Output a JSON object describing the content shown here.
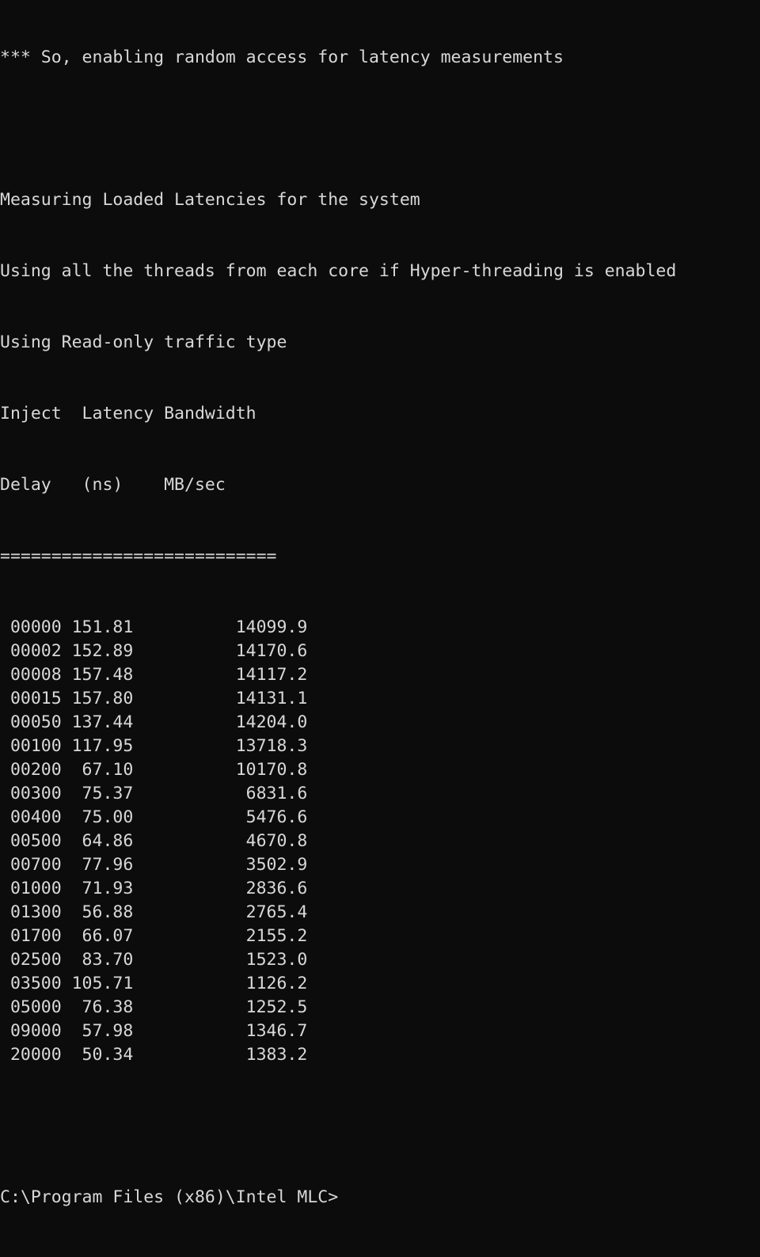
{
  "terminal": {
    "background_color": "#0c0c0c",
    "foreground_color": "#d8d8d8",
    "columns": 80,
    "rows": 29
  },
  "output": {
    "note_line": "*** So, enabling random access for latency measurements",
    "measuring_line": "Measuring Loaded Latencies for the system",
    "threads_line": "Using all the threads from each core if Hyper-threading is enabled",
    "traffic_line": "Using Read-only traffic type",
    "header_row_1": "Inject  Latency Bandwidth",
    "header_row_2": "Delay   (ns)    MB/sec",
    "separator": "==========================="
  },
  "table": {
    "columns": [
      "Inject Delay",
      "Latency (ns)",
      "Bandwidth MB/sec"
    ],
    "rows": [
      {
        "delay": "00000",
        "latency": "151.81",
        "bandwidth": "14099.9"
      },
      {
        "delay": "00002",
        "latency": "152.89",
        "bandwidth": "14170.6"
      },
      {
        "delay": "00008",
        "latency": "157.48",
        "bandwidth": "14117.2"
      },
      {
        "delay": "00015",
        "latency": "157.80",
        "bandwidth": "14131.1"
      },
      {
        "delay": "00050",
        "latency": "137.44",
        "bandwidth": "14204.0"
      },
      {
        "delay": "00100",
        "latency": "117.95",
        "bandwidth": "13718.3"
      },
      {
        "delay": "00200",
        "latency": "67.10",
        "bandwidth": "10170.8"
      },
      {
        "delay": "00300",
        "latency": "75.37",
        "bandwidth": "6831.6"
      },
      {
        "delay": "00400",
        "latency": "75.00",
        "bandwidth": "5476.6"
      },
      {
        "delay": "00500",
        "latency": "64.86",
        "bandwidth": "4670.8"
      },
      {
        "delay": "00700",
        "latency": "77.96",
        "bandwidth": "3502.9"
      },
      {
        "delay": "01000",
        "latency": "71.93",
        "bandwidth": "2836.6"
      },
      {
        "delay": "01300",
        "latency": "56.88",
        "bandwidth": "2765.4"
      },
      {
        "delay": "01700",
        "latency": "66.07",
        "bandwidth": "2155.2"
      },
      {
        "delay": "02500",
        "latency": "83.70",
        "bandwidth": "1523.0"
      },
      {
        "delay": "03500",
        "latency": "105.71",
        "bandwidth": "1126.2"
      },
      {
        "delay": "05000",
        "latency": "76.38",
        "bandwidth": "1252.5"
      },
      {
        "delay": "09000",
        "latency": "57.98",
        "bandwidth": "1346.7"
      },
      {
        "delay": "20000",
        "latency": "50.34",
        "bandwidth": "1383.2"
      }
    ]
  },
  "prompt": {
    "text": "C:\\Program Files (x86)\\Intel MLC>"
  }
}
